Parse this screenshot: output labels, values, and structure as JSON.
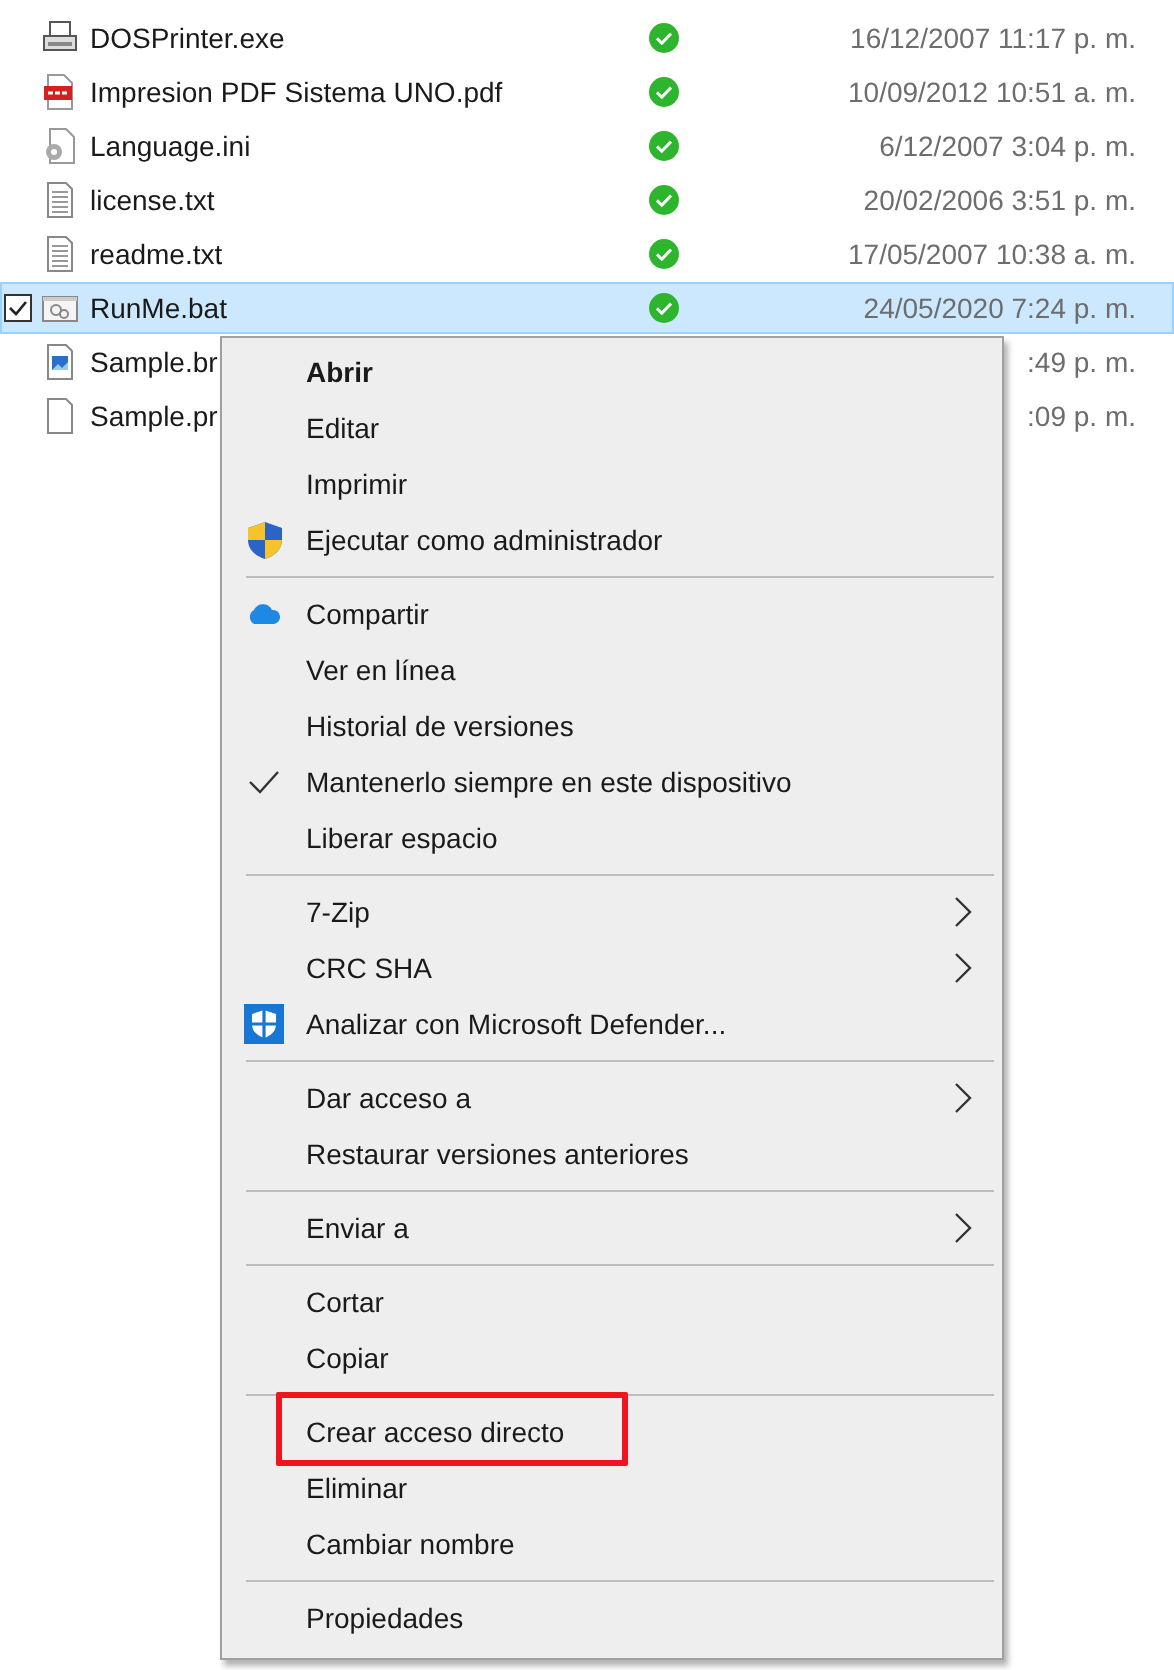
{
  "files": [
    {
      "name": "DOSPrinter.exe",
      "synced": true,
      "date": "16/12/2007 11:17 p. m.",
      "selected": false
    },
    {
      "name": "Impresion PDF Sistema UNO.pdf",
      "synced": true,
      "date": "10/09/2012 10:51 a. m.",
      "selected": false
    },
    {
      "name": "Language.ini",
      "synced": true,
      "date": "6/12/2007 3:04 p. m.",
      "selected": false
    },
    {
      "name": "license.txt",
      "synced": true,
      "date": "20/02/2006 3:51 p. m.",
      "selected": false
    },
    {
      "name": "readme.txt",
      "synced": true,
      "date": "17/05/2007 10:38 a. m.",
      "selected": false
    },
    {
      "name": "RunMe.bat",
      "synced": true,
      "date": "24/05/2020 7:24 p. m.",
      "selected": true
    },
    {
      "name": "Sample.br",
      "date": ":49 p. m.",
      "selected": false
    },
    {
      "name": "Sample.pr",
      "date": ":09 p. m.",
      "selected": false
    }
  ],
  "context_menu": {
    "groups": [
      [
        {
          "label": "Abrir",
          "default": true,
          "checked": false,
          "submenu": false,
          "highlighted": false
        },
        {
          "label": "Editar",
          "default": false,
          "checked": false,
          "submenu": false,
          "highlighted": false
        },
        {
          "label": "Imprimir",
          "default": false,
          "checked": false,
          "submenu": false,
          "highlighted": false
        },
        {
          "label": "Ejecutar como administrador",
          "default": false,
          "checked": false,
          "submenu": false,
          "highlighted": false
        }
      ],
      [
        {
          "label": "Compartir",
          "default": false,
          "checked": false,
          "submenu": false,
          "highlighted": false
        },
        {
          "label": "Ver en línea",
          "default": false,
          "checked": false,
          "submenu": false,
          "highlighted": false
        },
        {
          "label": "Historial de versiones",
          "default": false,
          "checked": false,
          "submenu": false,
          "highlighted": false
        },
        {
          "label": "Mantenerlo siempre en este dispositivo",
          "default": false,
          "checked": true,
          "submenu": false,
          "highlighted": false
        },
        {
          "label": "Liberar espacio",
          "default": false,
          "checked": false,
          "submenu": false,
          "highlighted": false
        }
      ],
      [
        {
          "label": "7-Zip",
          "default": false,
          "checked": false,
          "submenu": true,
          "highlighted": false
        },
        {
          "label": "CRC SHA",
          "default": false,
          "checked": false,
          "submenu": true,
          "highlighted": false
        },
        {
          "label": "Analizar con Microsoft Defender...",
          "default": false,
          "checked": false,
          "submenu": false,
          "highlighted": false
        }
      ],
      [
        {
          "label": "Dar acceso a",
          "default": false,
          "checked": false,
          "submenu": true,
          "highlighted": false
        },
        {
          "label": "Restaurar versiones anteriores",
          "default": false,
          "checked": false,
          "submenu": false,
          "highlighted": false
        }
      ],
      [
        {
          "label": "Enviar a",
          "default": false,
          "checked": false,
          "submenu": true,
          "highlighted": false
        }
      ],
      [
        {
          "label": "Cortar",
          "default": false,
          "checked": false,
          "submenu": false,
          "highlighted": false
        },
        {
          "label": "Copiar",
          "default": false,
          "checked": false,
          "submenu": false,
          "highlighted": false
        }
      ],
      [
        {
          "label": "Crear acceso directo",
          "default": false,
          "checked": false,
          "submenu": false,
          "highlighted": true
        },
        {
          "label": "Eliminar",
          "default": false,
          "checked": false,
          "submenu": false,
          "highlighted": false
        },
        {
          "label": "Cambiar nombre",
          "default": false,
          "checked": false,
          "submenu": false,
          "highlighted": false
        }
      ],
      [
        {
          "label": "Propiedades",
          "default": false,
          "checked": false,
          "submenu": false,
          "highlighted": false
        }
      ]
    ]
  }
}
